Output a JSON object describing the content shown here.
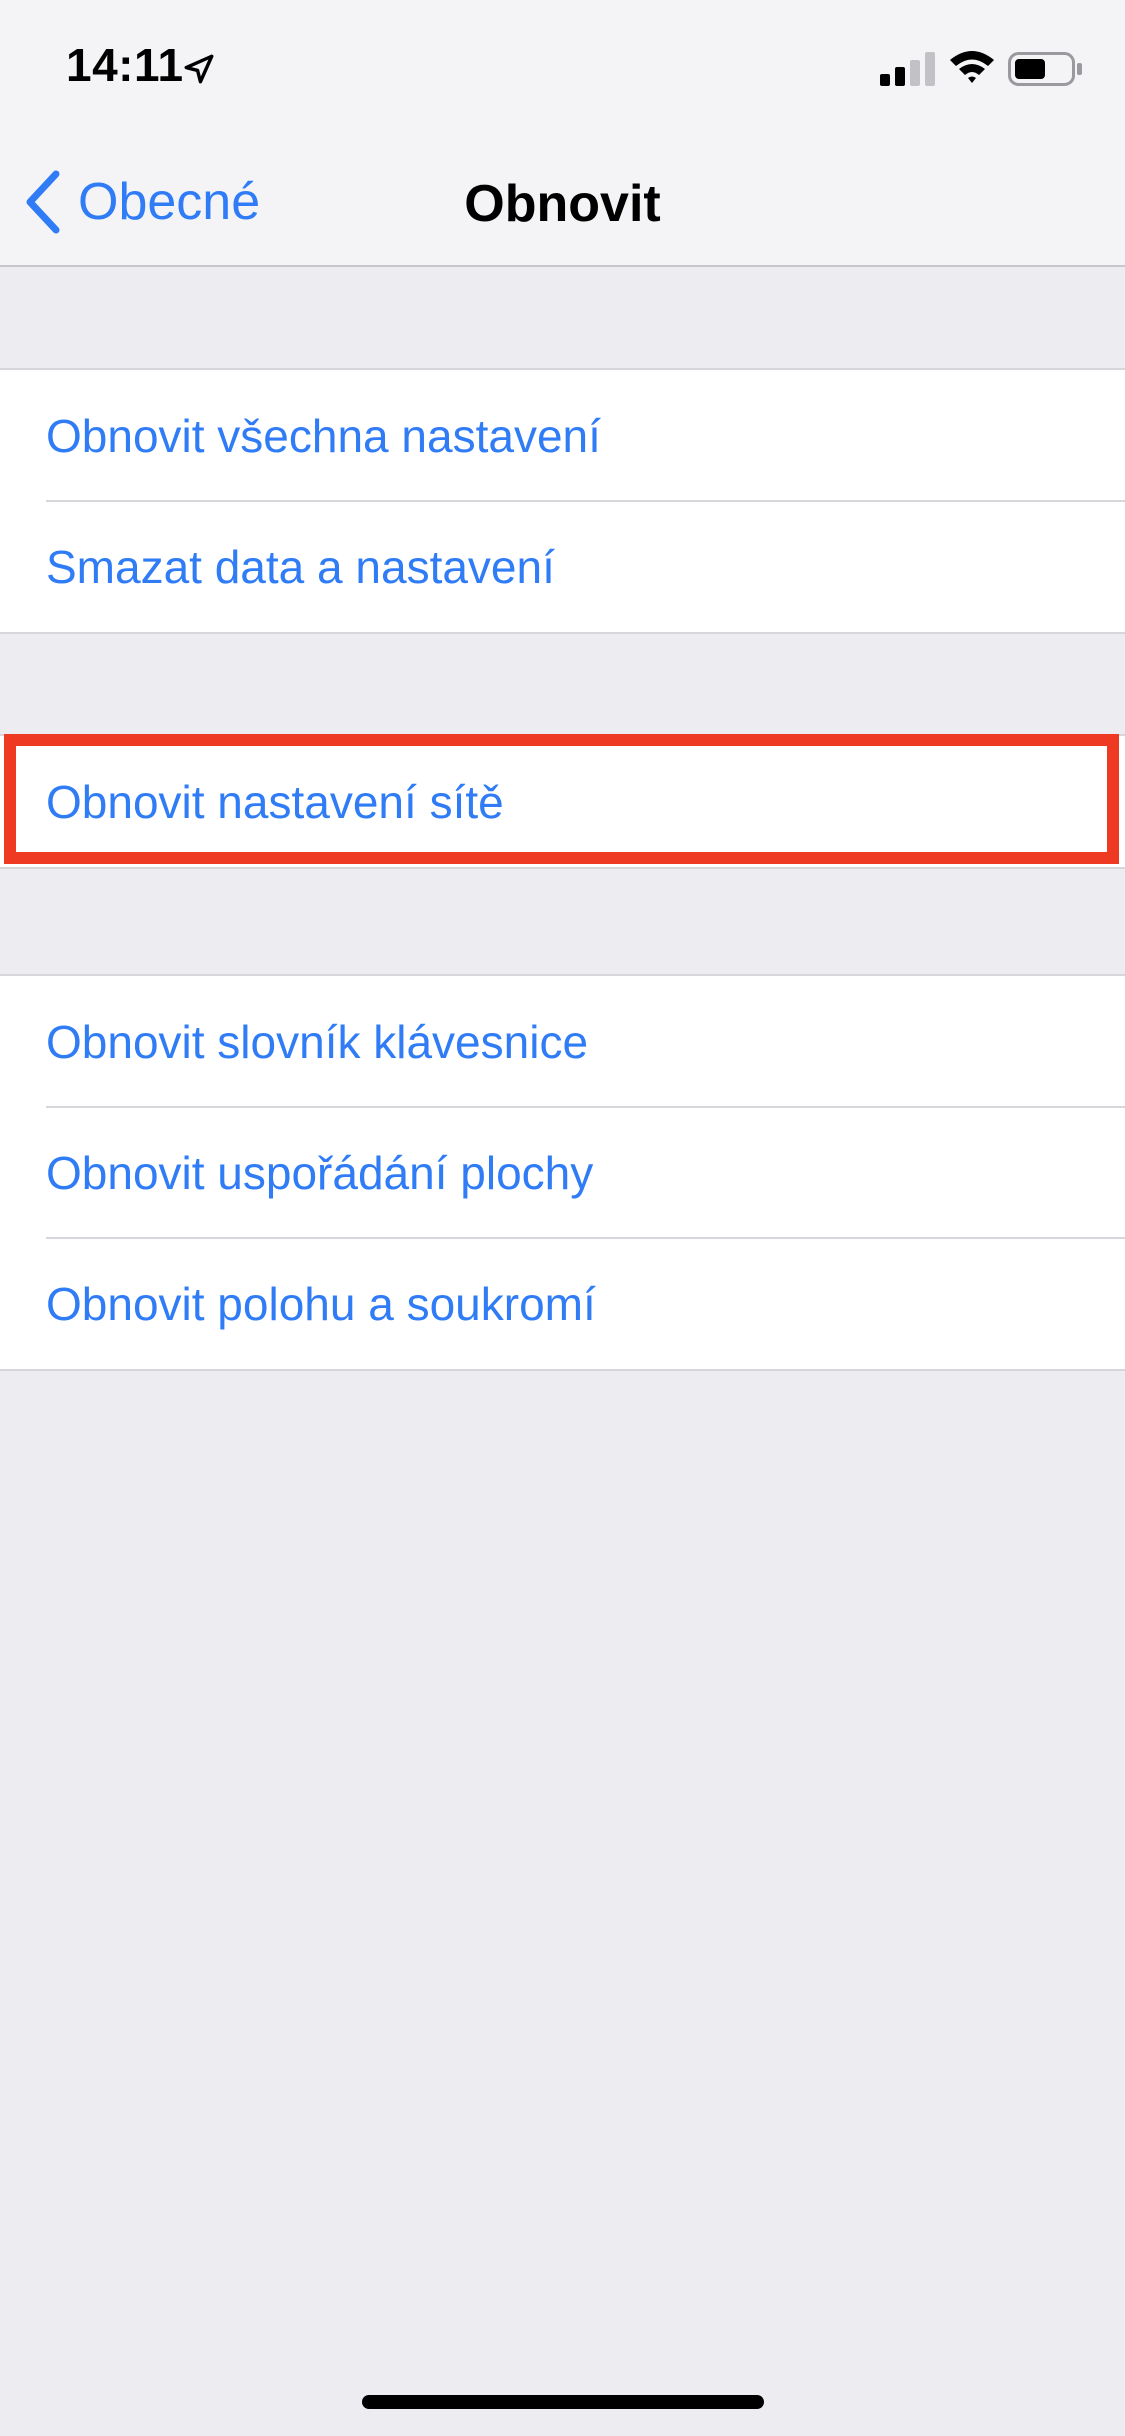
{
  "status_bar": {
    "time": "14:11",
    "icons": [
      "location-arrow-icon",
      "cellular-signal-icon",
      "wifi-icon",
      "battery-icon"
    ]
  },
  "nav": {
    "back_label": "Obecné",
    "title": "Obnovit"
  },
  "groups": [
    {
      "items": [
        {
          "label": "Obnovit všechna nastavení"
        },
        {
          "label": "Smazat data a nastavení"
        }
      ]
    },
    {
      "items": [
        {
          "label": "Obnovit nastavení sítě",
          "highlighted": true
        }
      ]
    },
    {
      "items": [
        {
          "label": "Obnovit slovník klávesnice"
        },
        {
          "label": "Obnovit uspořádání plochy"
        },
        {
          "label": "Obnovit polohu a soukromí"
        }
      ]
    }
  ],
  "colors": {
    "accent": "#2f7cf6",
    "highlight_frame": "#ee3a23",
    "background": "#efeff4"
  }
}
